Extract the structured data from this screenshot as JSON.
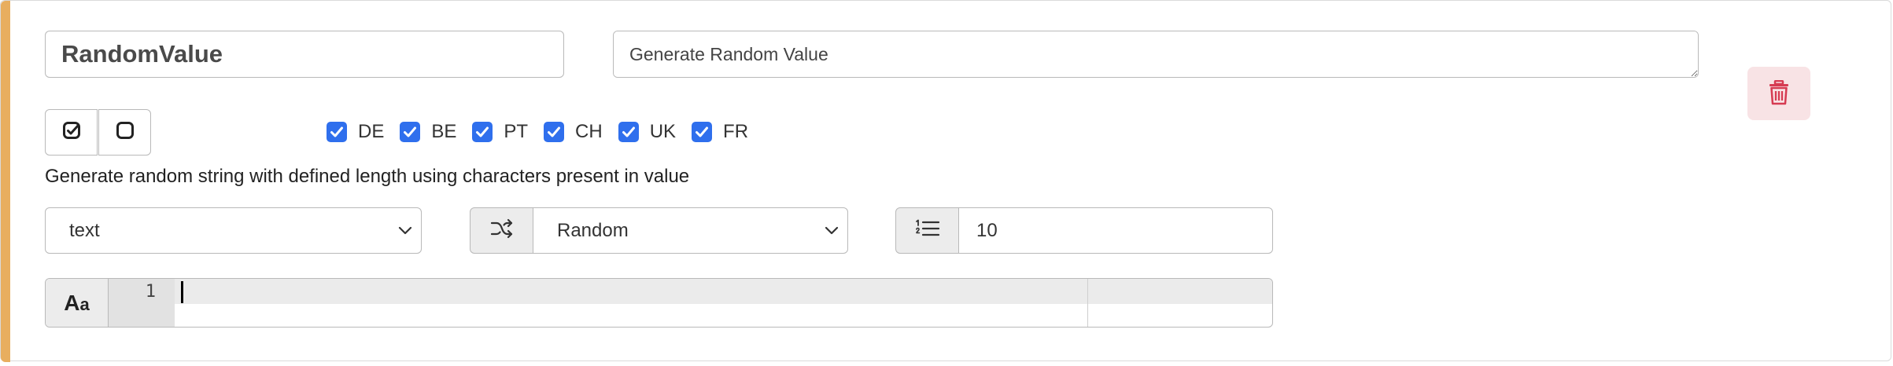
{
  "colors": {
    "accent": "#e8ae5f",
    "checkbox": "#2f6fed",
    "delete_bg": "#f8e3e5",
    "delete_icon": "#d63b52"
  },
  "rule": {
    "name": "RandomValue",
    "description": "Generate Random Value",
    "help_text": "Generate random string with defined length using characters present in value"
  },
  "toggle_buttons": {
    "check_all_icon": "square-check-icon",
    "uncheck_all_icon": "square-icon"
  },
  "countries": [
    {
      "code": "DE",
      "checked": true
    },
    {
      "code": "BE",
      "checked": true
    },
    {
      "code": "PT",
      "checked": true
    },
    {
      "code": "CH",
      "checked": true
    },
    {
      "code": "UK",
      "checked": true
    },
    {
      "code": "FR",
      "checked": true
    }
  ],
  "controls": {
    "type_select": "text",
    "mode_icon": "shuffle-icon",
    "mode_select": "Random",
    "length_icon": "list-numbered-icon",
    "length_value": "10"
  },
  "editor": {
    "toggle_label": "Aa",
    "line_numbers": [
      "1"
    ],
    "content": ""
  },
  "delete_icon": "trash-icon"
}
